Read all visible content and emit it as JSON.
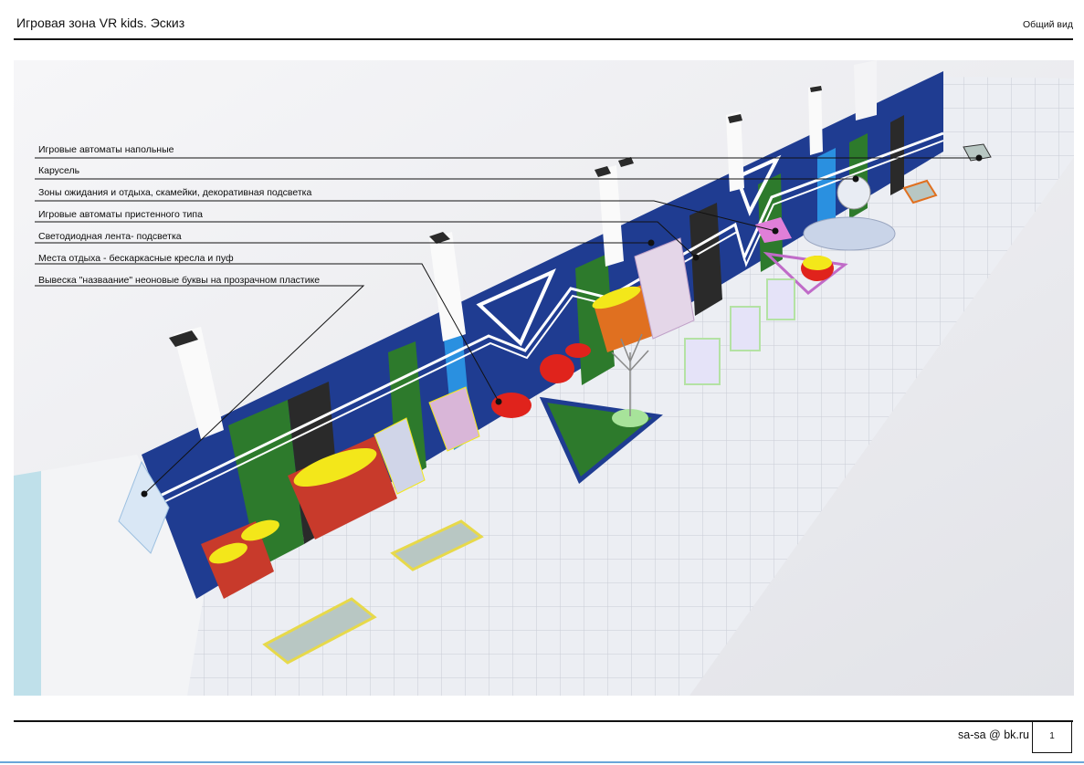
{
  "header": {
    "title": "Игровая зона VR kids. Эскиз",
    "view": "Общий вид"
  },
  "callouts": [
    {
      "id": "floor-arcade",
      "label": "Игровые автоматы напольные"
    },
    {
      "id": "carousel",
      "label": "Карусель"
    },
    {
      "id": "waiting-zones",
      "label": "Зоны ожидания и отдыха, скамейки, декоративная подсветка"
    },
    {
      "id": "wall-arcade",
      "label": "Игровые автоматы пристенного типа"
    },
    {
      "id": "led-strip",
      "label": "Светодиодная лента- подсветка"
    },
    {
      "id": "rest-places",
      "label": "Места отдыха - бескаркасные кресла и пуф"
    },
    {
      "id": "sign",
      "label": "Вывеска \"назваание\" неоновые буквы на прозрачном пластике"
    }
  ],
  "footer": {
    "email": "sa-sa @ bk.ru",
    "page_number": "1"
  },
  "colors": {
    "wall_navy": "#1f3c91",
    "wall_green": "#2d7a2c",
    "wall_black": "#2a2a2a",
    "accent_red": "#e0231c",
    "accent_yellow": "#f3e71a",
    "floor": "#ecedf2"
  }
}
